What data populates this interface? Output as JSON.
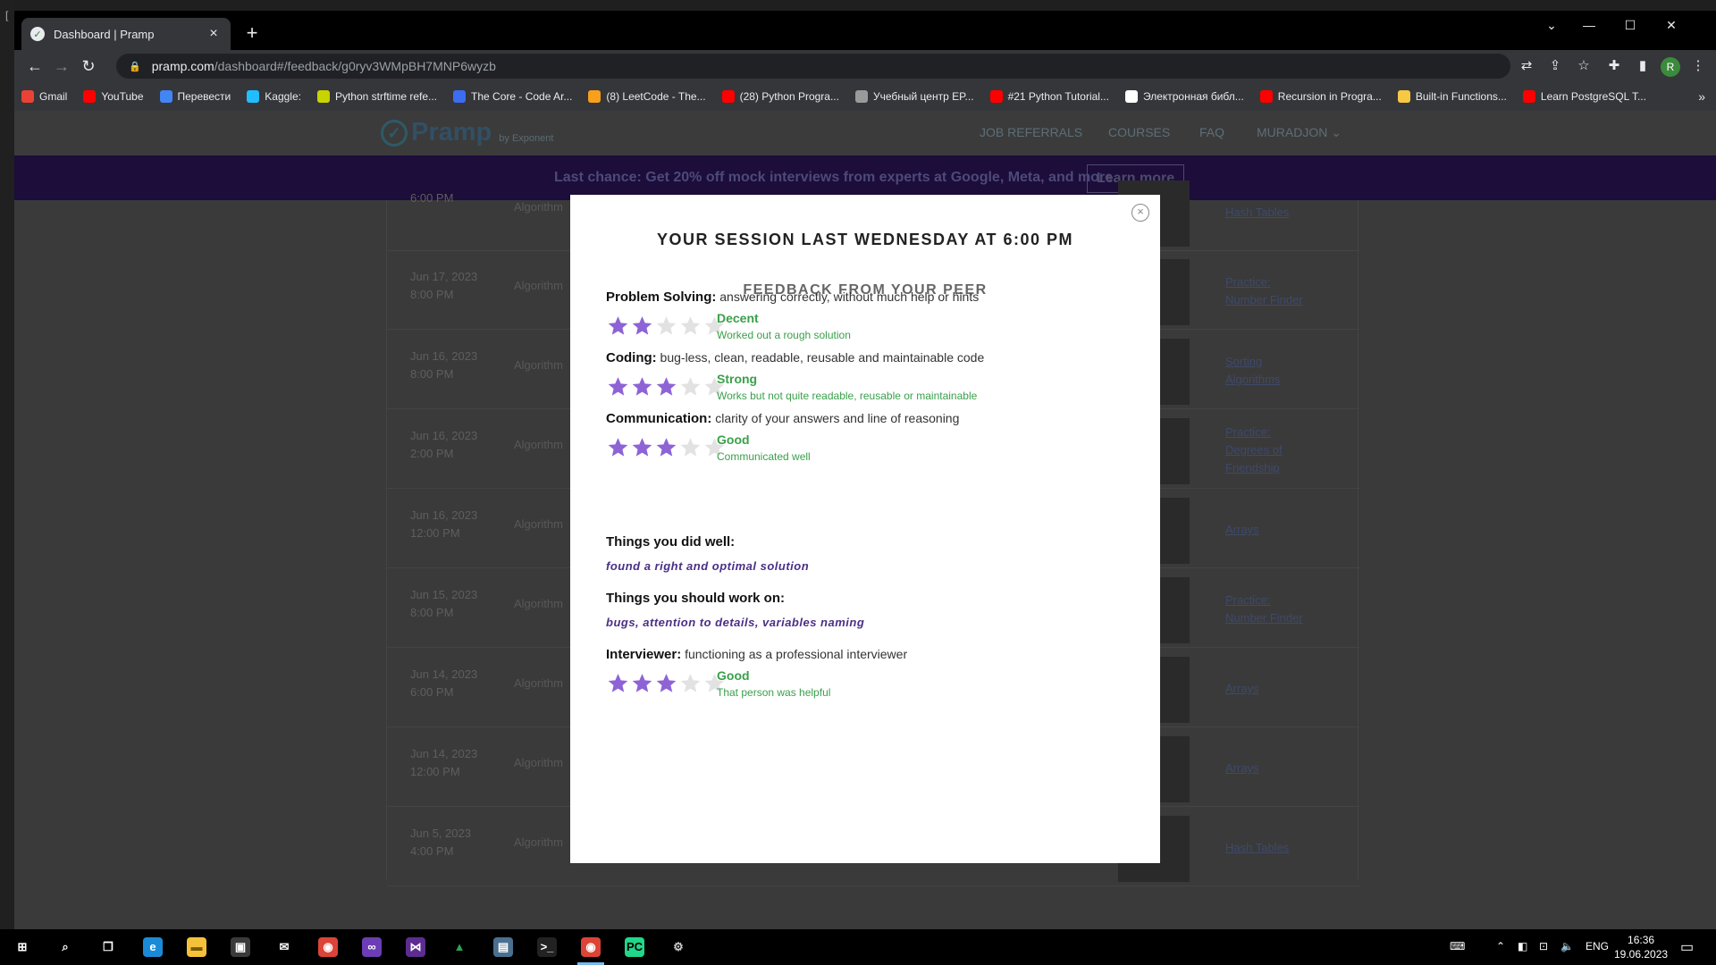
{
  "browser": {
    "tab_title": "Dashboard | Pramp",
    "tab_close": "×",
    "new_tab": "+",
    "url_host": "pramp.com",
    "url_path": "/dashboard#/feedback/g0ryv3WMpBH7MNP6wyzb",
    "profile_initial": "R",
    "bookmarks": [
      {
        "label": "Gmail",
        "color": "#ea4335"
      },
      {
        "label": "YouTube",
        "color": "#ff0000"
      },
      {
        "label": "Перевести",
        "color": "#4285f4"
      },
      {
        "label": "Kaggle:",
        "color": "#20beff"
      },
      {
        "label": "Python strftime refe...",
        "color": "#c8d400"
      },
      {
        "label": "The Core - Code Ar...",
        "color": "#3c6cf0"
      },
      {
        "label": "(8) LeetCode - The...",
        "color": "#f89f1b"
      },
      {
        "label": "(28) Python Progra...",
        "color": "#ff0000"
      },
      {
        "label": "Учебный центр EP...",
        "color": "#9a9a9a"
      },
      {
        "label": "#21 Python Tutorial...",
        "color": "#ff0000"
      },
      {
        "label": "Электронная библ...",
        "color": "#ffffff"
      },
      {
        "label": "Recursion in Progra...",
        "color": "#ff0000"
      },
      {
        "label": "Built-in Functions...",
        "color": "#f7c844"
      },
      {
        "label": "Learn PostgreSQL T...",
        "color": "#ff0000"
      }
    ],
    "bookmarks_more": "»"
  },
  "site": {
    "logo": "Pramp",
    "logo_sub": "by Exponent",
    "nav": [
      "JOB REFERRALS",
      "COURSES",
      "FAQ",
      "MURADJON"
    ],
    "promo_text": "Last chance: Get 20% off mock interviews from experts at Google, Meta, and more",
    "promo_button": "Learn more"
  },
  "sessions": [
    {
      "date": "",
      "time": "6:00 PM",
      "type": "Algorithm",
      "question": [
        "Hash Tables"
      ]
    },
    {
      "date": "Jun 17, 2023",
      "time": "8:00 PM",
      "type": "Algorithm",
      "question": [
        "Practice:",
        "Number Finder"
      ]
    },
    {
      "date": "Jun 16, 2023",
      "time": "8:00 PM",
      "type": "Algorithm",
      "question": [
        "Sorting",
        "Algorithms"
      ]
    },
    {
      "date": "Jun 16, 2023",
      "time": "2:00 PM",
      "type": "Algorithm",
      "question": [
        "Practice:",
        "Degrees of",
        "Friendship"
      ]
    },
    {
      "date": "Jun 16, 2023",
      "time": "12:00 PM",
      "type": "Algorithm",
      "question": [
        "Arrays"
      ]
    },
    {
      "date": "Jun 15, 2023",
      "time": "8:00 PM",
      "type": "Algorithm",
      "question": [
        "Practice:",
        "Number Finder"
      ]
    },
    {
      "date": "Jun 14, 2023",
      "time": "6:00 PM",
      "type": "Algorithm",
      "question": [
        "Arrays"
      ]
    },
    {
      "date": "Jun 14, 2023",
      "time": "12:00 PM",
      "type": "Algorithm",
      "question": [
        "Arrays"
      ]
    },
    {
      "date": "Jun 5, 2023",
      "time": "4:00 PM",
      "type": "Algorithm",
      "question": [
        "Hash Tables"
      ]
    }
  ],
  "modal": {
    "title": "YOUR SESSION LAST WEDNESDAY AT 6:00 PM",
    "subtitle": "FEEDBACK FROM YOUR PEER",
    "close_icon": "×",
    "criteria": [
      {
        "name": "Problem Solving:",
        "desc": "answering correctly, without much help or hints",
        "stars": 2,
        "max_stars": 5,
        "label": "Decent",
        "detail": "Worked out a rough solution"
      },
      {
        "name": "Coding:",
        "desc": "bug-less, clean, readable, reusable and maintainable code",
        "stars": 3,
        "max_stars": 5,
        "label": "Strong",
        "detail": "Works but not quite readable, reusable or maintainable"
      },
      {
        "name": "Communication:",
        "desc": "clarity of your answers and line of reasoning",
        "stars": 3,
        "max_stars": 5,
        "label": "Good",
        "detail": "Communicated well"
      }
    ],
    "did_well_head": "Things you did well:",
    "did_well": "found a right and optimal solution",
    "work_on_head": "Things you should work on:",
    "work_on": "bugs, attention to details, variables naming",
    "interviewer": {
      "name": "Interviewer:",
      "desc": "functioning as a professional interviewer",
      "stars": 3,
      "max_stars": 5,
      "label": "Good",
      "detail": "That person was helpful"
    }
  },
  "colors": {
    "star_on": "#8e63d6",
    "star_off": "#e2e2e2",
    "rating_green": "#3aa04b",
    "promo_bg": "#1c0d3a"
  },
  "taskbar": {
    "apps": [
      "start-icon",
      "search-icon",
      "task-view-icon",
      "edge-icon",
      "file-explorer-icon",
      "store-icon",
      "mail-icon",
      "chrome-icon",
      "visual-studio-icon",
      "visual-studio-code-icon",
      "drive-icon",
      "photos-icon",
      "terminal-icon",
      "chrome-active-icon",
      "pycharm-icon",
      "settings-icon"
    ],
    "lang": "ENG",
    "time": "16:36",
    "date": "19.06.2023"
  }
}
